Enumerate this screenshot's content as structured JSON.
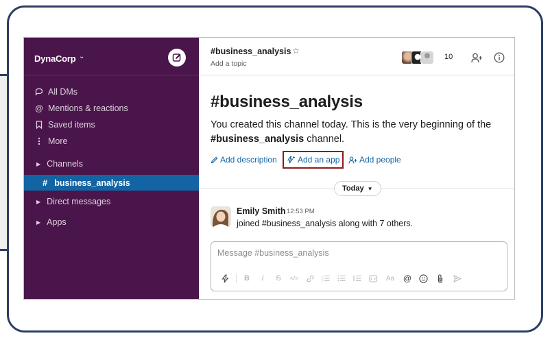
{
  "workspace": {
    "name": "DynaCorp"
  },
  "sidebar": {
    "items": [
      {
        "label": "All DMs",
        "icon": "all-dms-icon"
      },
      {
        "label": "Mentions & reactions",
        "icon": "at-icon"
      },
      {
        "label": "Saved items",
        "icon": "bookmark-icon"
      },
      {
        "label": "More",
        "icon": "more-vertical-icon"
      }
    ],
    "sections": {
      "channels": "Channels",
      "active_channel": "business_analysis",
      "direct_messages": "Direct messages",
      "apps": "Apps"
    }
  },
  "channel": {
    "name": "#business_analysis",
    "topic_placeholder": "Add a topic",
    "member_count": "10"
  },
  "intro": {
    "title": "#business_analysis",
    "text_1": "You created this channel today. This is the very beginning of the ",
    "text_bold": "#business_analysis",
    "text_2": " channel."
  },
  "actions": {
    "add_description": "Add description",
    "add_app": "Add an app",
    "add_people": "Add people"
  },
  "divider": {
    "label": "Today"
  },
  "message": {
    "author": "Emily Smith",
    "time": "12:53 PM",
    "text": "joined #business_analysis along with 7 others."
  },
  "composer": {
    "placeholder": "Message #business_analysis"
  },
  "colors": {
    "sidebar_bg": "#4a154b",
    "active_item": "#1264a3",
    "link": "#1264a3",
    "highlight_border": "#8b1a1a",
    "frame": "#2b3e63"
  }
}
